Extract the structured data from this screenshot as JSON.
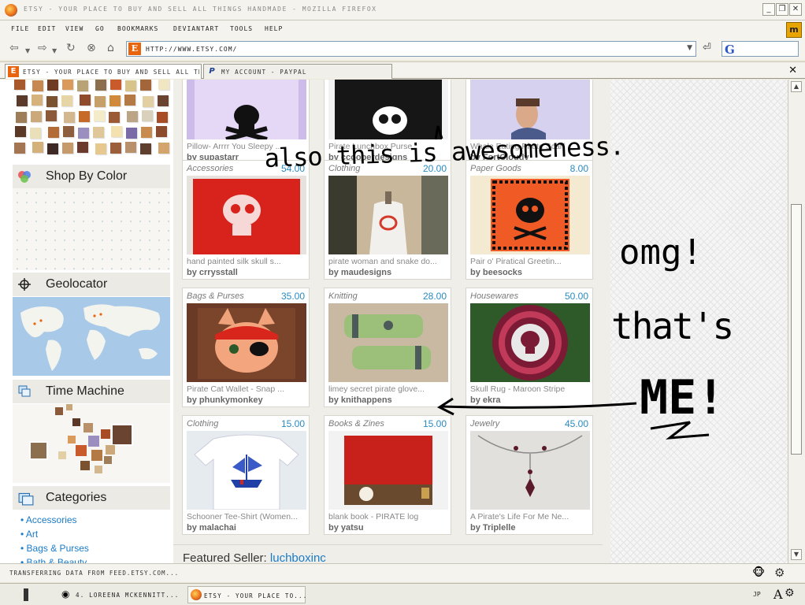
{
  "window": {
    "title": "ETSY - YOUR PLACE TO BUY AND SELL ALL THINGS HANDMADE - MOZILLA FIREFOX",
    "controls": [
      "_",
      "❐",
      "✕"
    ]
  },
  "menu": [
    "FILE",
    "EDIT",
    "VIEW",
    "GO",
    "BOOKMARKS",
    "DEVIANTART",
    "TOOLS",
    "HELP"
  ],
  "toolbar": {
    "url": "HTTP://WWW.ETSY.COM/",
    "search_engine": "G"
  },
  "tabs": [
    {
      "label": "ETSY - YOUR PLACE TO BUY AND SELL ALL TH...",
      "icon": "E",
      "active": true
    },
    {
      "label": "MY ACCOUNT - PAYPAL",
      "icon": "P",
      "active": false
    }
  ],
  "sidebar": {
    "sections": {
      "shop_by_color": "Shop By Color",
      "geolocator": "Geolocator",
      "time_machine": "Time Machine",
      "categories": "Categories"
    },
    "category_links": [
      "• Accessories",
      "• Art",
      "• Bags & Purses",
      "• Bath & Beauty"
    ],
    "swatch_colors": [
      "#a8592b",
      "#c7894f",
      "#6e3b24",
      "#d99a5b",
      "#b8a377",
      "#8c6f4e",
      "#c95a2b",
      "#d8c48a",
      "#a2663a",
      "#f0e6c2",
      "#5b3a2a",
      "#d6b27d",
      "#7a5230",
      "#e6d5a5",
      "#8f4b2c",
      "#c6a06a",
      "#d08a3a",
      "#b37a45",
      "#e2cfa3",
      "#6a4430",
      "#9e7d5a",
      "#cba97b",
      "#8a5a3a",
      "#d2b78f",
      "#c66a2a",
      "#f4ecc8",
      "#9a5a35",
      "#bca486",
      "#d9d1bb",
      "#a84c25",
      "#5c3826",
      "#e9dfb9",
      "#b36b38",
      "#8e5f3f",
      "#9b8fbf",
      "#e0c79a",
      "#f3e2b0",
      "#7b6aa8",
      "#c98a4e",
      "#8b4a2c",
      "#a37552",
      "#d4b07a",
      "#3e2a24",
      "#c79a6b",
      "#6a3a2e",
      "#e7c98f",
      "#9b5f3b",
      "#b8906a",
      "#5e3e2c",
      "#d3a46b"
    ]
  },
  "listings": [
    {
      "category": "",
      "price": "",
      "title": "Pillow- Arrrr You Sleepy ...",
      "seller": "by supastarr",
      "image": "pillow-skull"
    },
    {
      "category": "",
      "price": "",
      "title": "Pirate Lunchbox Purse",
      "seller": "by ccooperdesigns",
      "image": "lunchbox"
    },
    {
      "category": "",
      "price": "",
      "title": "Whale Eating Pirate Scarf",
      "seller": "by FortCloudy",
      "image": "scarf-model"
    },
    {
      "category": "Accessories",
      "price": "54.00",
      "title": "hand painted silk skull s...",
      "seller": "by crrysstall",
      "image": "red-scarf-skull"
    },
    {
      "category": "Clothing",
      "price": "20.00",
      "title": "pirate woman and snake do...",
      "seller": "by maudesigns",
      "image": "dress-form"
    },
    {
      "category": "Paper Goods",
      "price": "8.00",
      "title": "Pair o' Piratical Greetin...",
      "seller": "by beesocks",
      "image": "skull-card"
    },
    {
      "category": "Bags & Purses",
      "price": "35.00",
      "title": "Pirate Cat Wallet - Snap ...",
      "seller": "by phunkymonkey",
      "image": "cat-wallet"
    },
    {
      "category": "Knitting",
      "price": "28.00",
      "title": "limey secret pirate glove...",
      "seller": "by knithappens",
      "image": "gloves"
    },
    {
      "category": "Housewares",
      "price": "50.00",
      "title": "Skull Rug - Maroon Stripe",
      "seller": "by ekra",
      "image": "skull-rug"
    },
    {
      "category": "Clothing",
      "price": "15.00",
      "title": "Schooner Tee-Shirt (Women...",
      "seller": "by malachai",
      "image": "ship-tee"
    },
    {
      "category": "Books & Zines",
      "price": "15.00",
      "title": "blank book - PIRATE log",
      "seller": "by yatsu",
      "image": "red-book"
    },
    {
      "category": "Jewelry",
      "price": "45.00",
      "title": "A Pirate's Life For Me Ne...",
      "seller": "by Triplelle",
      "image": "necklace"
    }
  ],
  "featured": {
    "label": "Featured Seller:",
    "name": "luchboxinc"
  },
  "handwriting": {
    "line1": "also this is awesomeness.",
    "line2": "omg!",
    "line3": "that's",
    "line4": "ME!"
  },
  "status": {
    "text": "TRANSFERRING DATA FROM FEED.ETSY.COM..."
  },
  "taskbar": {
    "items": [
      "4. LOREENA MCKENNITT...",
      "ETSY - YOUR PLACE TO..."
    ],
    "lang": "JP",
    "ime": "A"
  },
  "colors": {
    "link": "#1a7bc9",
    "price": "#2a8ac0",
    "etsy_orange": "#e8650e"
  }
}
